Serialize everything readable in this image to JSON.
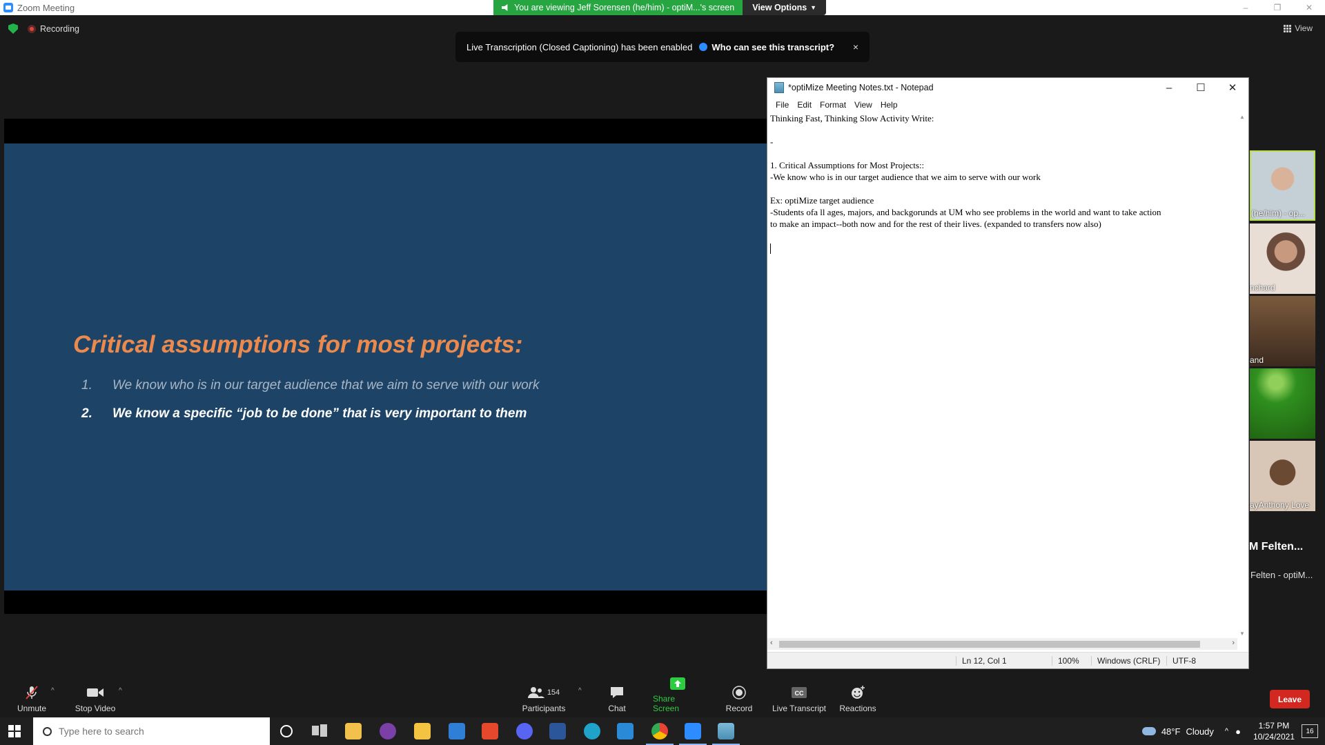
{
  "zoom": {
    "window_title": "Zoom Meeting",
    "share_banner": "You are viewing Jeff Sorensen (he/him) - optiM...'s screen",
    "view_options": "View Options",
    "recording": "Recording",
    "view": "View",
    "transcript_toast": {
      "message": "Live Transcription (Closed Captioning) has been enabled",
      "who_link": "Who can see this transcript?",
      "close": "×"
    }
  },
  "slide": {
    "title": "Critical assumptions for most projects:",
    "items": [
      {
        "num": "1.",
        "text": "We know who is in our target audience that we aim to serve with our work"
      },
      {
        "num": "2.",
        "text": "We know a specific “job to be done” that is very important to them"
      }
    ]
  },
  "notepad": {
    "title": "*optiMize Meeting Notes.txt - Notepad",
    "menu": [
      "File",
      "Edit",
      "Format",
      "View",
      "Help"
    ],
    "lines": [
      "Thinking Fast, Thinking Slow Activity Write:",
      "",
      "-",
      "",
      "1. Critical Assumptions for Most Projects::",
      "-We know who is in our target audience that we aim to serve with our work",
      "",
      "Ex: optiMize target audience",
      "-Students ofa ll ages, majors, and backgorunds at UM who see problems in the world and want to take action",
      "to make an impact--both now and for the rest of their lives. (expanded to transfers now also)",
      ""
    ],
    "status": {
      "position": "Ln 12, Col 1",
      "zoom": "100%",
      "line_ending": "Windows (CRLF)",
      "encoding": "UTF-8"
    }
  },
  "participants": [
    {
      "label": "(he/him) - op..."
    },
    {
      "label": "nchard"
    },
    {
      "label": "and"
    },
    {
      "label": ""
    },
    {
      "label": "ayAnthony Love"
    }
  ],
  "active_speaker": {
    "name": "M Felten...",
    "sub": "Felten - optiM..."
  },
  "toolbar": {
    "unmute": "Unmute",
    "stop_video": "Stop Video",
    "participants": "Participants",
    "participant_count": "154",
    "chat": "Chat",
    "share_screen": "Share Screen",
    "record": "Record",
    "live_transcript": "Live Transcript",
    "reactions": "Reactions",
    "leave": "Leave"
  },
  "taskbar": {
    "search_placeholder": "Type here to search",
    "weather_temp": "48°F",
    "weather_cond": "Cloudy",
    "time": "1:57 PM",
    "date": "10/24/2021",
    "notifications": "16"
  },
  "colors": {
    "slide_bg": "#1d4466",
    "slide_title": "#ec8a4d",
    "share_green": "#26a541",
    "leave_red": "#d3281f"
  }
}
